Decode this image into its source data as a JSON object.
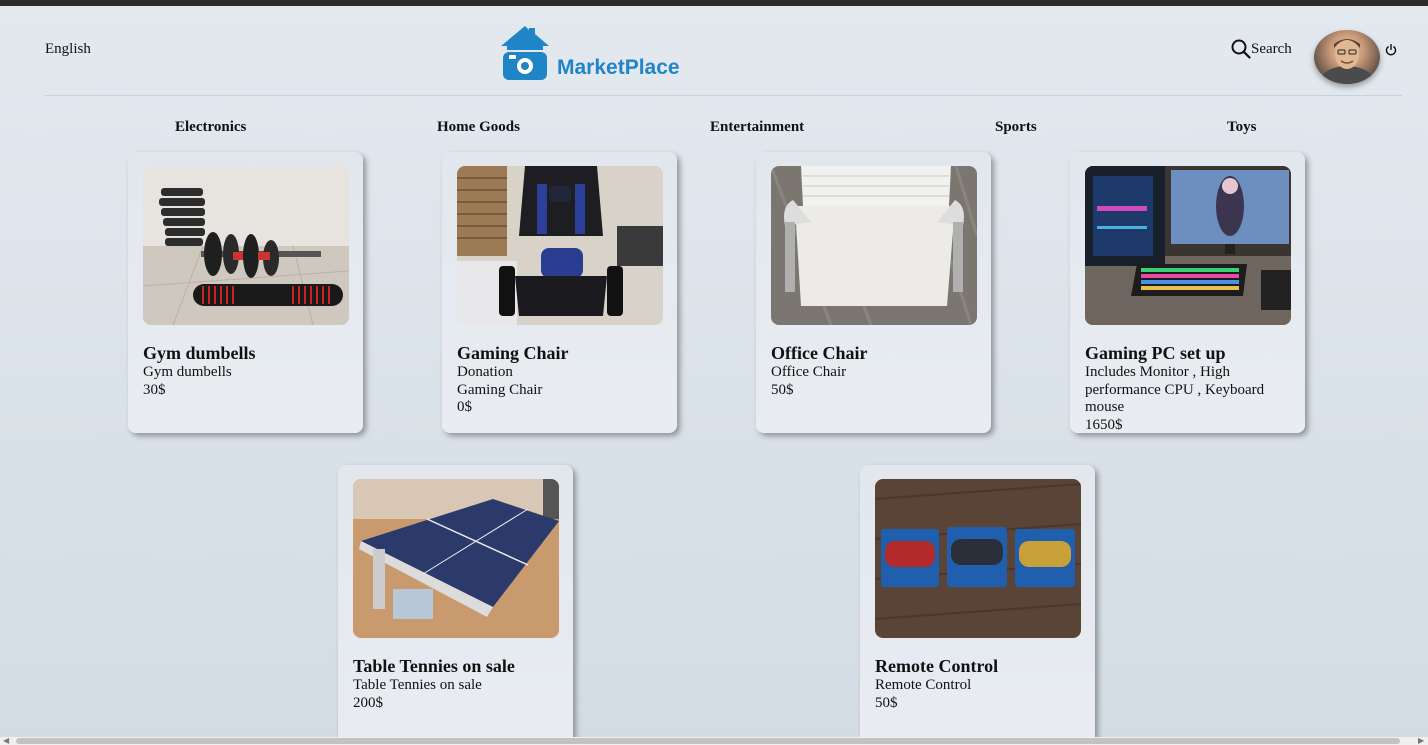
{
  "header": {
    "language": "English",
    "logo_text": "MarketPlace",
    "search_label": "Search",
    "icons": [
      "house-logo-icon",
      "search-icon",
      "avatar",
      "power-icon"
    ]
  },
  "categories": [
    "Electronics",
    "Home Goods",
    "Entertainment",
    "Sports",
    "Toys"
  ],
  "products": [
    {
      "title": "Gym dumbells",
      "lines": [
        "Gym dumbells",
        "30$"
      ]
    },
    {
      "title": "Gaming Chair",
      "lines": [
        "Donation",
        "Gaming Chair",
        "0$"
      ]
    },
    {
      "title": "Office Chair",
      "lines": [
        "Office Chair",
        "50$"
      ]
    },
    {
      "title": "Gaming PC set up",
      "lines": [
        "Includes Monitor , High performance CPU , Keyboard mouse",
        "1650$"
      ]
    },
    {
      "title": "Table Tennies on sale",
      "lines": [
        "Table Tennies on sale",
        "200$"
      ]
    },
    {
      "title": "Remote Control",
      "lines": [
        "Remote Control",
        "50$"
      ]
    }
  ],
  "colors": {
    "accent": "#1f85c7",
    "background": "#dde4eb"
  }
}
